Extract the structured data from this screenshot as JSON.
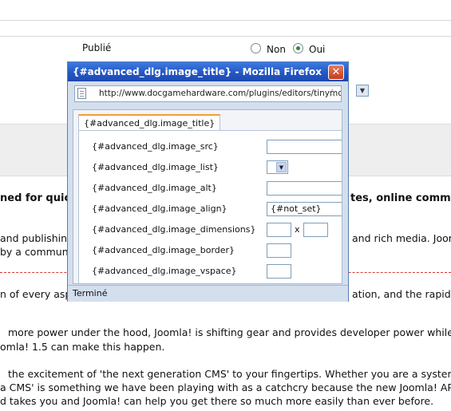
{
  "background": {
    "field_label": "Publié",
    "radio_no": "Non",
    "radio_yes": "Oui",
    "heading_left": "ned for quick",
    "heading_right": "tes, online commu",
    "lines": [
      {
        "left": "and publishing",
        "right": "and rich media. Joom"
      },
      {
        "left": "by a communi",
        "right": ""
      },
      {
        "left": "n of every asp",
        "right": "ation, and the rapid in"
      },
      {
        "left": "more power under the hood, Joomla! is shifting gear and provides developer power while ma",
        "right": ""
      },
      {
        "left": "omla! 1.5 can make this happen.",
        "right": ""
      },
      {
        "left": "the excitement of 'the next generation CMS' to your fingertips. Whether you are a systems a",
        "right": ""
      },
      {
        "left": "a CMS' is something we have been playing with as a catchcry because the new Joomla! API ha",
        "right": ""
      },
      {
        "left": "d takes you and Joomla! can help you get there so much more easily than ever before.",
        "right": ""
      }
    ]
  },
  "popup": {
    "window_title": "{#advanced_dlg.image_title} - Mozilla Firefox",
    "close_glyph": "✕",
    "url": "http://www.docgamehardware.com/plugins/editors/tinymce",
    "star_glyph": "☆",
    "tab_label": "{#advanced_dlg.image_title}",
    "fields": {
      "src_label": "{#advanced_dlg.image_src}",
      "list_label": "{#advanced_dlg.image_list}",
      "alt_label": "{#advanced_dlg.image_alt}",
      "align_label": "{#advanced_dlg.image_align}",
      "align_value": "{#not_set}",
      "dimensions_label": "{#advanced_dlg.image_dimensions}",
      "dimensions_sep": "x",
      "border_label": "{#advanced_dlg.image_border}",
      "vspace_label": "{#advanced_dlg.image_vspace}"
    },
    "status_text": "Terminé"
  }
}
